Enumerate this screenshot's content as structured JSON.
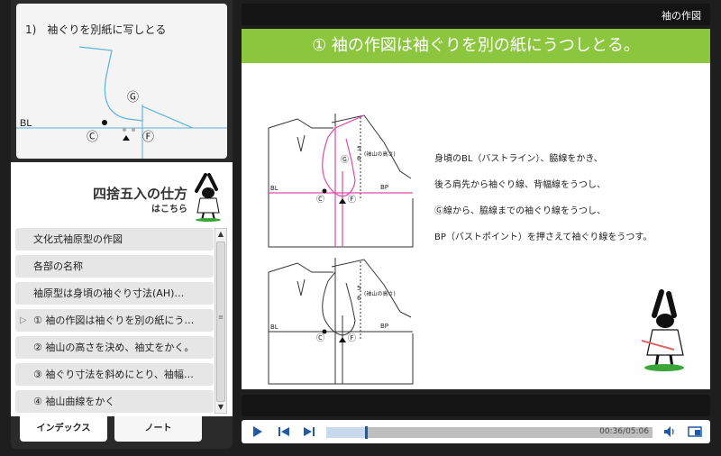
{
  "thumbnail": {
    "title": "1)　袖ぐりを別紙に写しとる",
    "bl_label": "BL",
    "marks": {
      "c": "Ⓒ",
      "g": "Ⓖ",
      "f": "Ⓕ"
    }
  },
  "promo": {
    "title": "四捨五入の仕方",
    "subtitle": "はこちら"
  },
  "index": {
    "items": [
      {
        "label": "文化式袖原型の作図",
        "active": false
      },
      {
        "label": "各部の名称",
        "active": false
      },
      {
        "label": "袖原型は身頃の袖ぐり寸法(AH)…",
        "active": false
      },
      {
        "label": "① 袖の作図は袖ぐりを別の紙にう…",
        "active": true
      },
      {
        "label": "② 袖山の高さを決め、袖丈をかく。",
        "active": false
      },
      {
        "label": "③ 袖ぐり寸法を斜めにとり、袖幅…",
        "active": false
      },
      {
        "label": "④ 袖山曲線をかく",
        "active": false
      }
    ],
    "active_marker": "▷"
  },
  "tabs": {
    "index_label": "インデックス",
    "note_label": "ノート"
  },
  "topbar": {
    "title": "袖の作図"
  },
  "slide": {
    "header": "① 袖の作図は袖ぐりを別の紙にうつしとる。",
    "lines": [
      "身頃のBL（バストライン）、脇線をかき、",
      "後ろ肩先から袖ぐり線、背幅線をうつし、",
      "Ⓖ線から、脇線までの袖ぐり線をうつし、",
      "BP（バストポイント）を押さえて袖ぐり線をうつす。"
    ],
    "diagram": {
      "bl": "BL",
      "bp": "BP",
      "height_label": "(袖山の高さ)",
      "fraction_num": "5",
      "fraction_den": "6",
      "c": "Ⓒ",
      "g": "Ⓖ",
      "f": "Ⓕ"
    }
  },
  "player": {
    "time": "00:36/05:06",
    "progress": 0.12
  },
  "colors": {
    "accent_green": "#8cc63f",
    "pink": "#e04aa8",
    "player_blue": "#1f5aa8"
  }
}
